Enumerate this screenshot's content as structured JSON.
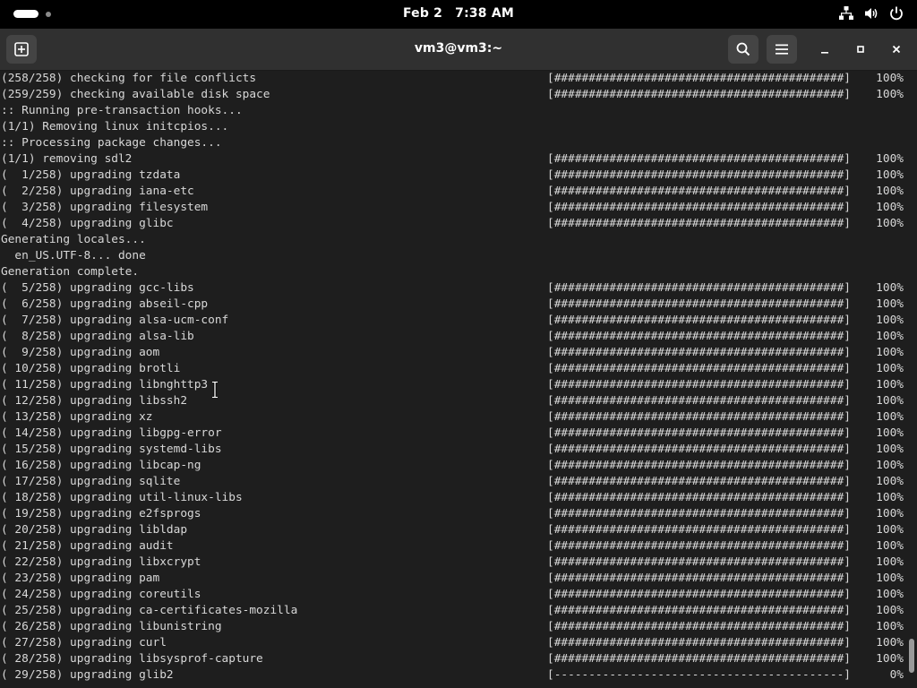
{
  "topbar": {
    "date": "Feb 2",
    "time": "7:38 AM",
    "icons": [
      "network-icon",
      "volume-icon",
      "power-icon"
    ]
  },
  "window": {
    "title": "vm3@vm3:~",
    "icons": [
      "new-tab-icon",
      "search-icon",
      "menu-icon",
      "minimize-icon",
      "maximize-icon",
      "close-icon"
    ]
  },
  "terminal": {
    "scroll_position": 0.98,
    "lines": [
      {
        "text": "(258/258) checking for file conflicts",
        "bar": "[##########################################]",
        "pct": "100%"
      },
      {
        "text": "(259/259) checking available disk space",
        "bar": "[##########################################]",
        "pct": "100%"
      },
      {
        "text": ":: Running pre-transaction hooks...",
        "bar": "",
        "pct": ""
      },
      {
        "text": "(1/1) Removing linux initcpios...",
        "bar": "",
        "pct": ""
      },
      {
        "text": ":: Processing package changes...",
        "bar": "",
        "pct": ""
      },
      {
        "text": "(1/1) removing sdl2",
        "bar": "[##########################################]",
        "pct": "100%"
      },
      {
        "text": "(  1/258) upgrading tzdata",
        "bar": "[##########################################]",
        "pct": "100%"
      },
      {
        "text": "(  2/258) upgrading iana-etc",
        "bar": "[##########################################]",
        "pct": "100%"
      },
      {
        "text": "(  3/258) upgrading filesystem",
        "bar": "[##########################################]",
        "pct": "100%"
      },
      {
        "text": "(  4/258) upgrading glibc",
        "bar": "[##########################################]",
        "pct": "100%"
      },
      {
        "text": "Generating locales...",
        "bar": "",
        "pct": ""
      },
      {
        "text": "  en_US.UTF-8... done",
        "bar": "",
        "pct": ""
      },
      {
        "text": "Generation complete.",
        "bar": "",
        "pct": ""
      },
      {
        "text": "(  5/258) upgrading gcc-libs",
        "bar": "[##########################################]",
        "pct": "100%"
      },
      {
        "text": "(  6/258) upgrading abseil-cpp",
        "bar": "[##########################################]",
        "pct": "100%"
      },
      {
        "text": "(  7/258) upgrading alsa-ucm-conf",
        "bar": "[##########################################]",
        "pct": "100%"
      },
      {
        "text": "(  8/258) upgrading alsa-lib",
        "bar": "[##########################################]",
        "pct": "100%"
      },
      {
        "text": "(  9/258) upgrading aom",
        "bar": "[##########################################]",
        "pct": "100%"
      },
      {
        "text": "( 10/258) upgrading brotli",
        "bar": "[##########################################]",
        "pct": "100%"
      },
      {
        "text": "( 11/258) upgrading libnghttp3",
        "bar": "[##########################################]",
        "pct": "100%"
      },
      {
        "text": "( 12/258) upgrading libssh2",
        "bar": "[##########################################]",
        "pct": "100%"
      },
      {
        "text": "( 13/258) upgrading xz",
        "bar": "[##########################################]",
        "pct": "100%"
      },
      {
        "text": "( 14/258) upgrading libgpg-error",
        "bar": "[##########################################]",
        "pct": "100%"
      },
      {
        "text": "( 15/258) upgrading systemd-libs",
        "bar": "[##########################################]",
        "pct": "100%"
      },
      {
        "text": "( 16/258) upgrading libcap-ng",
        "bar": "[##########################################]",
        "pct": "100%"
      },
      {
        "text": "( 17/258) upgrading sqlite",
        "bar": "[##########################################]",
        "pct": "100%"
      },
      {
        "text": "( 18/258) upgrading util-linux-libs",
        "bar": "[##########################################]",
        "pct": "100%"
      },
      {
        "text": "( 19/258) upgrading e2fsprogs",
        "bar": "[##########################################]",
        "pct": "100%"
      },
      {
        "text": "( 20/258) upgrading libldap",
        "bar": "[##########################################]",
        "pct": "100%"
      },
      {
        "text": "( 21/258) upgrading audit",
        "bar": "[##########################################]",
        "pct": "100%"
      },
      {
        "text": "( 22/258) upgrading libxcrypt",
        "bar": "[##########################################]",
        "pct": "100%"
      },
      {
        "text": "( 23/258) upgrading pam",
        "bar": "[##########################################]",
        "pct": "100%"
      },
      {
        "text": "( 24/258) upgrading coreutils",
        "bar": "[##########################################]",
        "pct": "100%"
      },
      {
        "text": "( 25/258) upgrading ca-certificates-mozilla",
        "bar": "[##########################################]",
        "pct": "100%"
      },
      {
        "text": "( 26/258) upgrading libunistring",
        "bar": "[##########################################]",
        "pct": "100%"
      },
      {
        "text": "( 27/258) upgrading curl",
        "bar": "[##########################################]",
        "pct": "100%"
      },
      {
        "text": "( 28/258) upgrading libsysprof-capture",
        "bar": "[##########################################]",
        "pct": "100%"
      },
      {
        "text": "( 29/258) upgrading glib2",
        "bar": "[------------------------------------------]",
        "pct": "0%"
      }
    ]
  }
}
